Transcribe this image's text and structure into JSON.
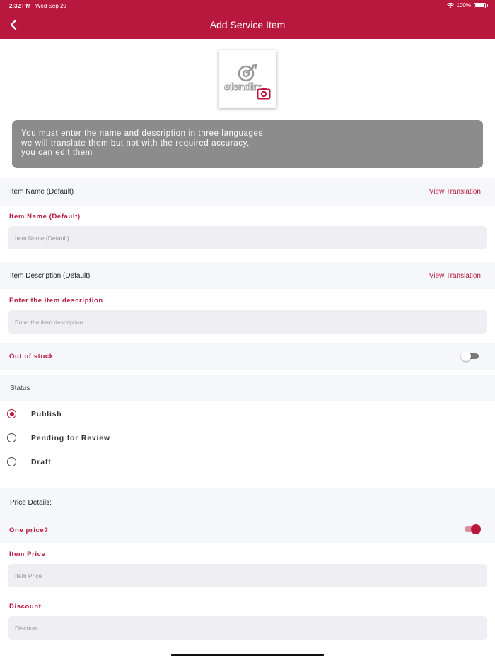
{
  "status_bar": {
    "time": "2:32 PM",
    "date": "Wed Sep 29",
    "battery": "100%"
  },
  "nav": {
    "title": "Add Service Item"
  },
  "photo": {
    "logo_text": "efendim"
  },
  "notice": {
    "lines": [
      "You must enter the name and description in three languages,",
      "we will translate them but not with the required accuracy,",
      "you can edit them"
    ]
  },
  "item_name": {
    "section_label": "Item Name (Default)",
    "link": "View Translation",
    "field_label": "Item Name (Default)",
    "placeholder": "Item Name (Default)"
  },
  "item_description": {
    "section_label": "Item Description (Default)",
    "link": "View Translation",
    "field_label": "Enter the item description",
    "placeholder": "Enter the item description"
  },
  "out_of_stock": {
    "label": "Out of stock",
    "enabled": false
  },
  "status": {
    "label": "Status",
    "options": [
      "Publish",
      "Pending for Review",
      "Draft"
    ],
    "selected": "Publish"
  },
  "price": {
    "section_label": "Price Details:",
    "one_price_label": "One price?",
    "one_price_enabled": true,
    "item_price_label": "Item Price",
    "item_price_placeholder": "Item Price",
    "discount_label": "Discount",
    "discount_placeholder": "Discount"
  },
  "colors": {
    "brand": "#b8183e",
    "notice_bg": "#8c8c8c",
    "band_bg": "#f6f7fb",
    "input_bg": "#eeeef3"
  }
}
